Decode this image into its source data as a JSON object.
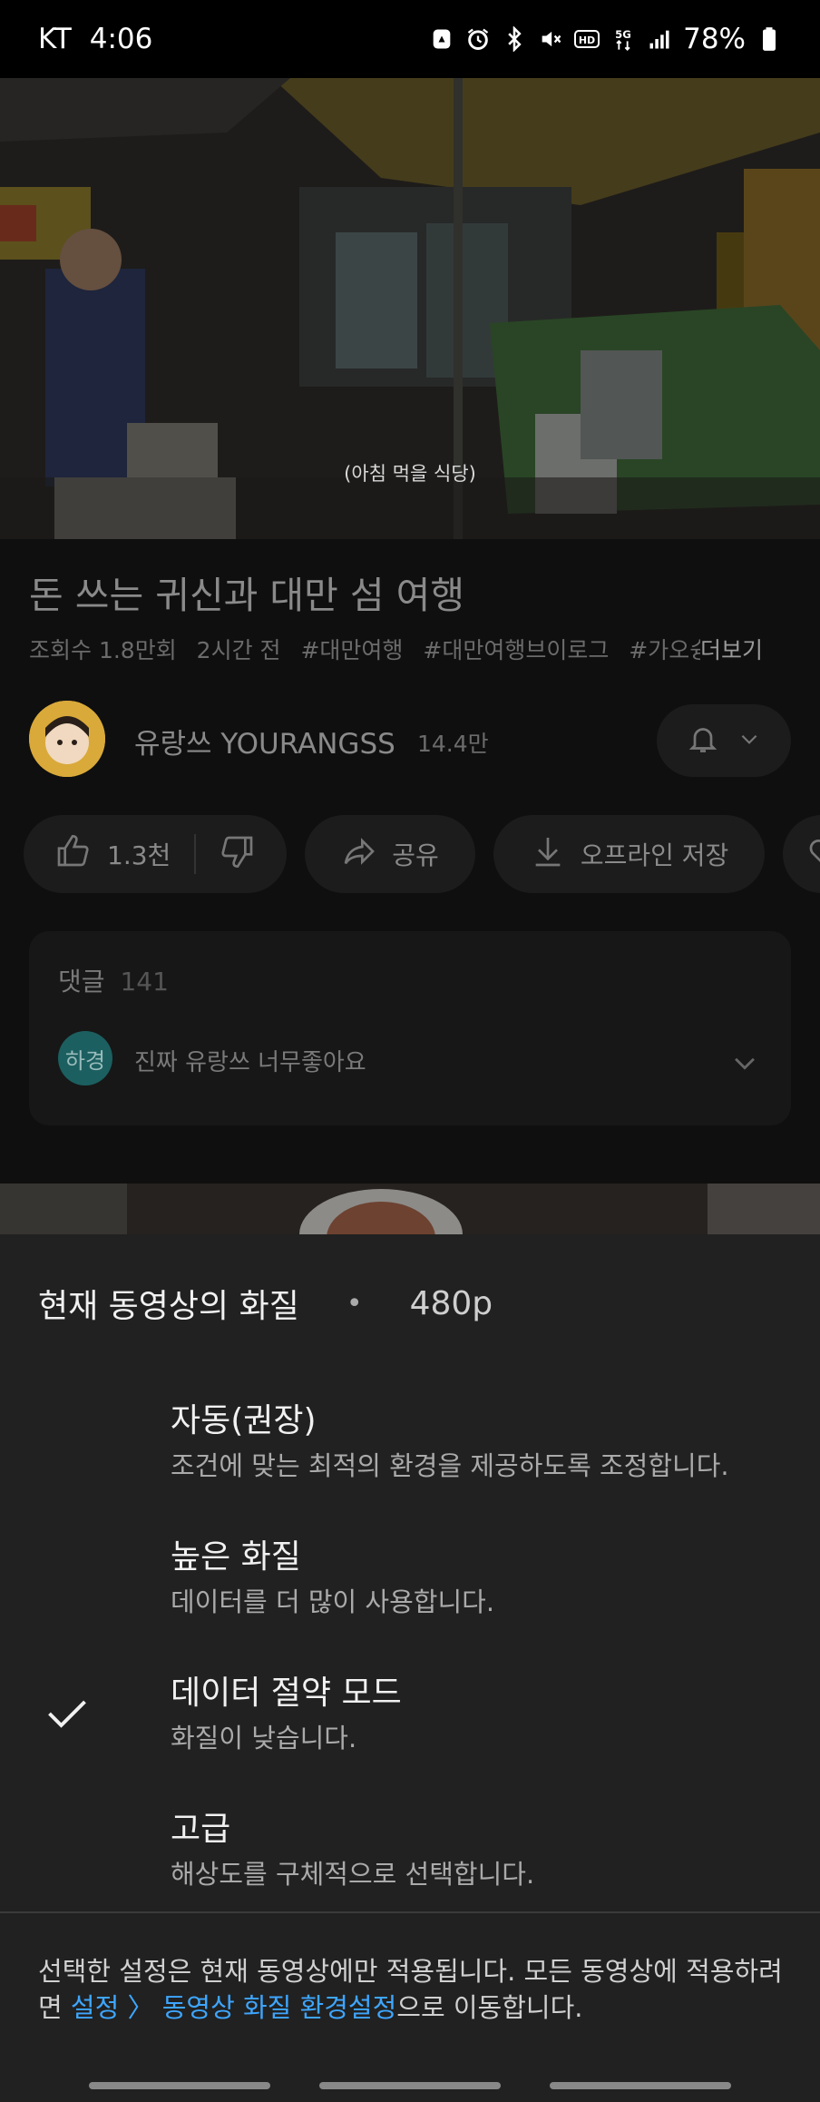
{
  "status_bar": {
    "carrier": "KT",
    "time": "4:06",
    "battery": "78%",
    "icons": [
      "notification-icon",
      "alarm-icon",
      "bluetooth-icon",
      "mute-icon",
      "hd-icon",
      "5g-icon",
      "signal-icon",
      "battery-icon"
    ]
  },
  "video": {
    "subtitle": "(아침 먹을 식당)"
  },
  "details": {
    "title": "돈 쓰는 귀신과 대만 섬 여행",
    "views": "조회수 1.8만회",
    "age": "2시간 전",
    "tags": [
      "#대만여행",
      "#대만여행브이로그",
      "#가오슝"
    ],
    "more": "더보기"
  },
  "channel": {
    "name": "유랑쓰 YOURANGSS",
    "subscribers": "14.4만"
  },
  "actions": {
    "likes": "1.3천",
    "share": "공유",
    "download": "오프라인 저장"
  },
  "comments": {
    "label": "댓글",
    "count": "141",
    "top_author": "하경",
    "top_comment": "진짜 유랑쓰 너무좋아요"
  },
  "quality_sheet": {
    "header": "현재 동영상의 화질",
    "separator": "•",
    "current": "480p",
    "options": [
      {
        "title": "자동(권장)",
        "desc": "조건에 맞는 최적의 환경을 제공하도록 조정합니다.",
        "selected": false
      },
      {
        "title": "높은 화질",
        "desc": "데이터를 더 많이 사용합니다.",
        "selected": false
      },
      {
        "title": "데이터 절약 모드",
        "desc": "화질이 낮습니다.",
        "selected": true
      },
      {
        "title": "고급",
        "desc": "해상도를 구체적으로 선택합니다.",
        "selected": false
      }
    ],
    "note_prefix": "선택한 설정은 현재 동영상에만 적용됩니다. 모든 동영상에 적용하려면 ",
    "note_link": "설정 〉 동영상 화질 환경설정",
    "note_suffix": "으로 이동합니다."
  },
  "colors": {
    "background": "#0f0f0f",
    "sheet": "#212121",
    "link": "#3ea6ff"
  }
}
